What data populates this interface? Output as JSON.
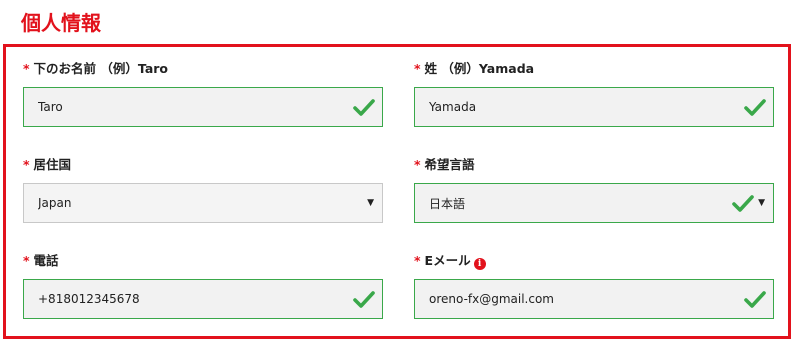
{
  "colors": {
    "accent": "#e2121c",
    "valid_border": "#3aa84a",
    "neutral_border": "#c8c8c8",
    "valid_bg": "#f2f2f2",
    "neutral_bg": "#f4f4f4",
    "check": "#3aa84a"
  },
  "section": {
    "title": "個人情報"
  },
  "fields": {
    "first_name": {
      "required_mark": "*",
      "label": "下のお名前 （例）Taro",
      "value": "Taro",
      "valid": true,
      "icon": "check-icon"
    },
    "last_name": {
      "required_mark": "*",
      "label": "姓 （例）Yamada",
      "value": "Yamada",
      "valid": true,
      "icon": "check-icon"
    },
    "country": {
      "required_mark": "*",
      "label": "居住国",
      "value": "Japan",
      "valid": false,
      "icon": "caret-down-icon"
    },
    "language": {
      "required_mark": "*",
      "label": "希望言語",
      "value": "日本語",
      "valid": true,
      "icon": "check-icon"
    },
    "phone": {
      "required_mark": "*",
      "label": "電話",
      "value": "+818012345678",
      "valid": true,
      "icon": "check-icon"
    },
    "email": {
      "required_mark": "*",
      "label": "Eメール",
      "info_glyph": "i",
      "value": "oreno-fx@gmail.com",
      "valid": true,
      "icon": "check-icon"
    }
  }
}
